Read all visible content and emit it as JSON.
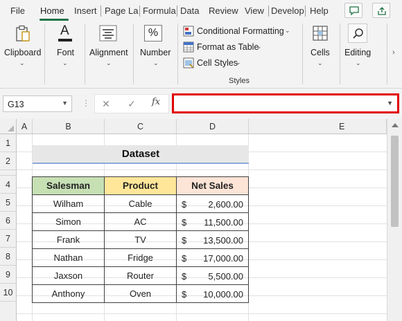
{
  "menu": {
    "tabs": [
      "File",
      "Home",
      "Insert",
      "Page La",
      "Formula",
      "Data",
      "Review",
      "View",
      "Develop",
      "Help"
    ],
    "active": "Home"
  },
  "ribbon": {
    "clipboard": "Clipboard",
    "font": "Font",
    "alignment": "Alignment",
    "number": "Number",
    "number_symbol": "%",
    "font_symbol": "A",
    "conditional_formatting": "Conditional Formatting",
    "format_as_table": "Format as Table",
    "cell_styles": "Cell Styles",
    "styles_group": "Styles",
    "cells": "Cells",
    "editing": "Editing"
  },
  "formula_bar": {
    "name_box": "G13",
    "fx": "fx",
    "formula": ""
  },
  "grid": {
    "columns": [
      "A",
      "B",
      "C",
      "D",
      "E"
    ],
    "rows": [
      "1",
      "2",
      "3",
      "4",
      "5",
      "6",
      "7",
      "8",
      "9",
      "10"
    ]
  },
  "sheet": {
    "title": "Dataset",
    "headers": [
      "Salesman",
      "Product",
      "Net Sales"
    ],
    "header_colors": [
      "#c6e0b4",
      "#ffe699",
      "#fce4d6"
    ],
    "currency_symbol": "$",
    "rows": [
      {
        "salesman": "Wilham",
        "product": "Cable",
        "net_sales": "2,600.00"
      },
      {
        "salesman": "Simon",
        "product": "AC",
        "net_sales": "11,500.00"
      },
      {
        "salesman": "Frank",
        "product": "TV",
        "net_sales": "13,500.00"
      },
      {
        "salesman": "Nathan",
        "product": "Fridge",
        "net_sales": "17,000.00"
      },
      {
        "salesman": "Jaxson",
        "product": "Router",
        "net_sales": "5,500.00"
      },
      {
        "salesman": "Anthony",
        "product": "Oven",
        "net_sales": "10,000.00"
      }
    ]
  },
  "colors": {
    "accent": "#217346",
    "highlight_border": "#e00000",
    "title_underline": "#8ea9db"
  }
}
